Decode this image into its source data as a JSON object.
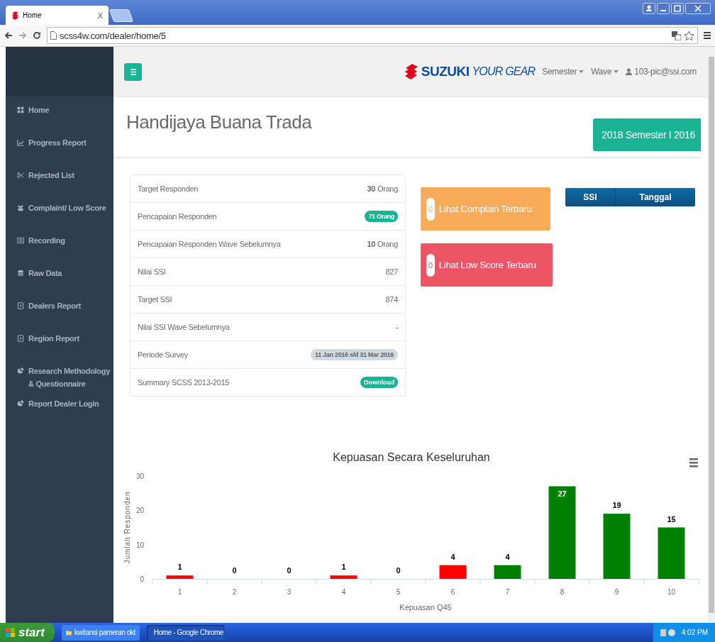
{
  "browser": {
    "tab": {
      "title": "Home",
      "close": "X"
    },
    "url": "scss4w.com/dealer/home/5"
  },
  "navbar": {
    "brand": {
      "name": "SUZUKI",
      "tagline": "YOUR GEAR"
    },
    "menus": [
      {
        "label": "Semester"
      },
      {
        "label": "Wave"
      }
    ],
    "user": "103-pic@ssi.com"
  },
  "sidebar": {
    "items": [
      {
        "label": "Home"
      },
      {
        "label": "Progress Report"
      },
      {
        "label": "Rejected List"
      },
      {
        "label": "Complaint/ Low Score"
      },
      {
        "label": "Recording"
      },
      {
        "label": "Raw Data"
      },
      {
        "label": "Dealers Report"
      },
      {
        "label": "Region Report"
      },
      {
        "label": "Research Methodology & Questionnaire"
      },
      {
        "label": "Report Dealer Login"
      }
    ]
  },
  "page": {
    "title": "Handijaya Buana Trada",
    "period": "2018 Semester I 2016"
  },
  "summary": [
    {
      "label": "Target Responden",
      "value": "**30** Orang",
      "kind": "text"
    },
    {
      "label": "Pencapaian Responden",
      "value": "71 Orang",
      "kind": "badge"
    },
    {
      "label": "Pencapaian Responden Wave Sebelumnya",
      "value": "**10** Orang",
      "kind": "text"
    },
    {
      "label": "Nilai SSI",
      "value": "827",
      "kind": "text"
    },
    {
      "label": "Target SSI",
      "value": "874",
      "kind": "text"
    },
    {
      "label": "Nilai SSI Wave Sebelumnya",
      "value": "-",
      "kind": "text"
    },
    {
      "label": "Periode Survey",
      "value": "11 Jan 2016 s/d 31 Mar 2016",
      "kind": "date"
    },
    {
      "label": "Summary SCSS 2013-2015",
      "value": "Download",
      "kind": "button"
    }
  ],
  "alerts": [
    {
      "count": "0",
      "label": "Lihat Complain Terbaru",
      "kind": "warning"
    },
    {
      "count": "0",
      "label": "Lihat Low Score Terbaru",
      "kind": "danger"
    }
  ],
  "ssi_table": {
    "columns": [
      "SSI",
      "Tanggal"
    ]
  },
  "chart": {
    "chart_data": {
      "type": "bar",
      "title": "Kepuasan Secara Keseluruhan",
      "xlabel": "Kepuasan Q45",
      "ylabel": "Jumlah Responden",
      "categories": [
        "1",
        "2",
        "3",
        "4",
        "5",
        "6",
        "7",
        "8",
        "9",
        "10"
      ],
      "stacked": true,
      "data_labels": true,
      "ylim": [
        0,
        30
      ],
      "yticks": [
        0,
        10,
        20,
        30
      ],
      "series": [
        {
          "color": "#ff0000",
          "values": [
            1,
            0,
            0,
            1,
            0,
            4,
            null,
            null,
            null,
            null
          ]
        },
        {
          "color": "#008000",
          "values": [
            null,
            null,
            null,
            null,
            null,
            null,
            4,
            27,
            19,
            15
          ]
        }
      ]
    }
  },
  "taskbar": {
    "start": "start",
    "tasks": [
      {
        "label": "kwitansi pameran okt",
        "selected": false
      },
      {
        "label": "Home - Google Chrome",
        "selected": true
      }
    ],
    "clock": "4:02 PM"
  }
}
